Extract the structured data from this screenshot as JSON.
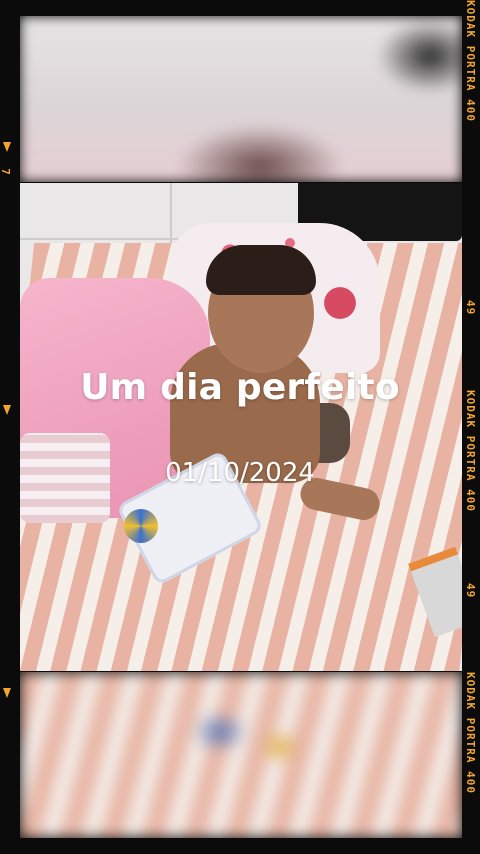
{
  "overlay": {
    "title": "Um dia perfeito",
    "date": "01/10/2024"
  },
  "film_edge": {
    "brand_label_1": "KODAK PORTRA 400",
    "frame_number_1": "49",
    "brand_label_2": "KODAK PORTRA 400",
    "frame_number_2": "49",
    "brand_label_3": "KODAK PORTRA 400",
    "left_number": "7",
    "accent_color": "#f0a630"
  },
  "icons": [
    "film-arrow-marker"
  ]
}
